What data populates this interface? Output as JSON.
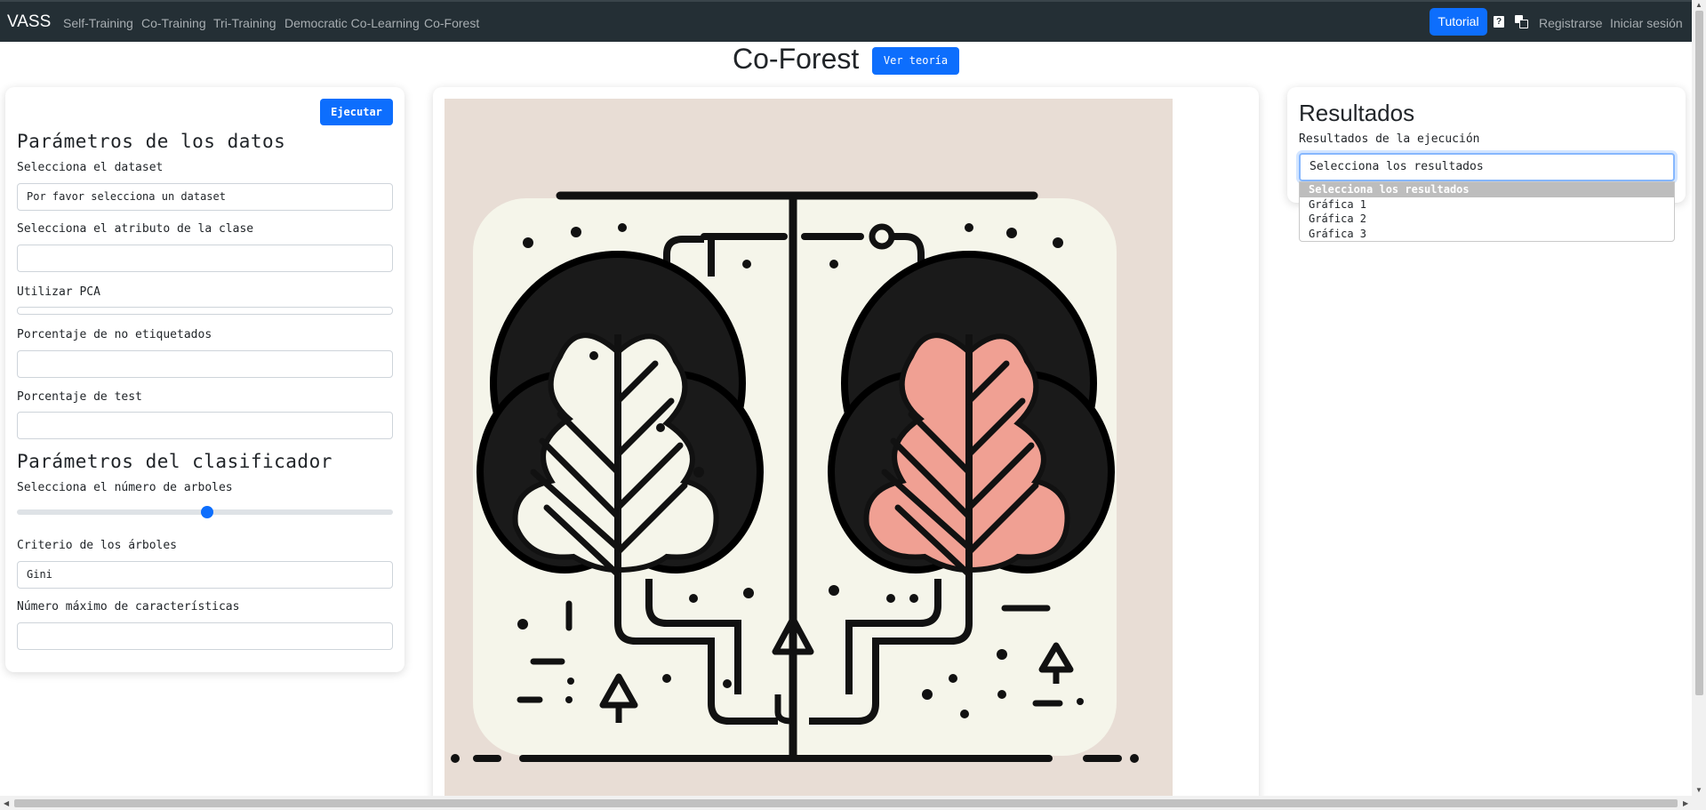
{
  "navbar": {
    "brand": "VASS",
    "links": [
      "Self-Training",
      "Co-Training",
      "Tri-Training",
      "Democratic Co-Learning",
      "Co-Forest"
    ],
    "tutorial": "Tutorial",
    "help_icon": "?",
    "register": "Registrarse",
    "login": "Iniciar sesión"
  },
  "page": {
    "title": "Co-Forest",
    "theory_button": "Ver teoría"
  },
  "left": {
    "execute": "Ejecutar",
    "data_section": "Parámetros de los datos",
    "dataset_label": "Selecciona el dataset",
    "dataset_value": "Por favor selecciona un dataset",
    "class_label": "Selecciona el atributo de la clase",
    "class_value": "",
    "pca_label": "Utilizar PCA",
    "unlabeled_label": "Porcentaje de no etiquetados",
    "unlabeled_value": "",
    "test_label": "Porcentaje de test",
    "test_value": "",
    "classifier_section": "Parámetros del clasificador",
    "trees_label": "Selecciona el número de arboles",
    "trees_slider_fraction": 0.5,
    "criterion_label": "Criterio de los árboles",
    "criterion_value": "Gini",
    "maxfeat_label": "Número máximo de características",
    "maxfeat_value": ""
  },
  "right": {
    "title": "Resultados",
    "label": "Resultados de la ejecución",
    "select_value": "Selecciona los resultados",
    "options": [
      "Selecciona los resultados",
      "Gráfica 1",
      "Gráfica 2",
      "Gráfica 3"
    ]
  },
  "colors": {
    "navbar_bg": "#242f35",
    "primary": "#0d6efd",
    "image_bg": "#e8ddd5",
    "tree_red": "#f0a093",
    "tree_cream": "#f5f5ea"
  }
}
